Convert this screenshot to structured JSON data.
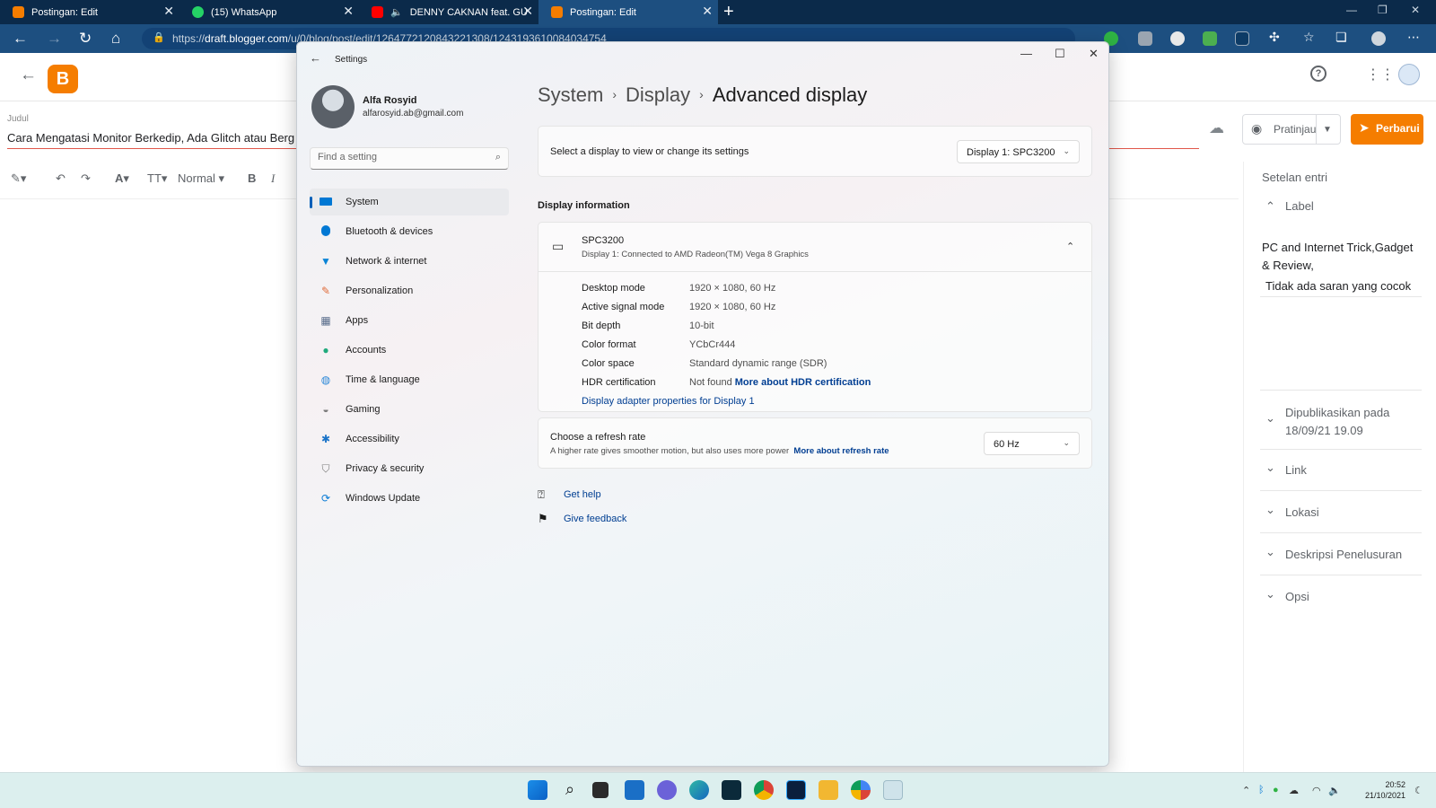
{
  "browser": {
    "tabs": [
      {
        "title": "Postingan: Edit",
        "icon": "blogger-icon",
        "color": "#f57d00"
      },
      {
        "title": "(15) WhatsApp",
        "icon": "whatsapp-icon",
        "color": "#25d366"
      },
      {
        "title": "DENNY CAKNAN feat. GUYON",
        "icon": "youtube-icon",
        "color": "#ff0000"
      },
      {
        "title": "Postingan: Edit",
        "icon": "blogger-icon",
        "color": "#f57d00"
      }
    ],
    "url_prefix": "https://",
    "url_host": "draft.blogger.com",
    "url_path": "/u/0/blog/post/edit/1264772120843221308/1243193610084034754"
  },
  "blogger": {
    "title_label": "Judul",
    "post_title": "Cara Mengatasi Monitor Berkedip, Ada Glitch atau Berg",
    "format_select": "Normal",
    "preview_label": "Pratinjau",
    "update_label": "Perbarui",
    "panel": {
      "heading": "Setelan entri",
      "label_section": "Label",
      "labels_value": "PC and Internet Trick,Gadget & Review,",
      "label_hint": "Tidak ada saran yang cocok",
      "published_title": "Dipublikasikan pada",
      "published_date": "18/09/21 19.09",
      "link": "Link",
      "location": "Lokasi",
      "search_desc": "Deskripsi Penelusuran",
      "options": "Opsi"
    }
  },
  "settings": {
    "caption": "Settings",
    "user": {
      "name": "Alfa Rosyid",
      "email": "alfarosyid.ab@gmail.com"
    },
    "search_placeholder": "Find a setting",
    "nav": [
      {
        "label": "System",
        "icon": "system-icon",
        "color": "#0078d4"
      },
      {
        "label": "Bluetooth & devices",
        "icon": "bluetooth-icon",
        "color": "#0078d4"
      },
      {
        "label": "Network & internet",
        "icon": "wifi-icon",
        "color": "#0a84d6"
      },
      {
        "label": "Personalization",
        "icon": "brush-icon",
        "color": "#e06c3a"
      },
      {
        "label": "Apps",
        "icon": "apps-icon",
        "color": "#5a6e8c"
      },
      {
        "label": "Accounts",
        "icon": "person-icon",
        "color": "#1faa7c"
      },
      {
        "label": "Time & language",
        "icon": "globe-clock-icon",
        "color": "#2b88d8"
      },
      {
        "label": "Gaming",
        "icon": "gamepad-icon",
        "color": "#7a7a7a"
      },
      {
        "label": "Accessibility",
        "icon": "accessibility-icon",
        "color": "#1a73c8"
      },
      {
        "label": "Privacy & security",
        "icon": "shield-icon",
        "color": "#7a7a7a"
      },
      {
        "label": "Windows Update",
        "icon": "update-icon",
        "color": "#0a7bd6"
      }
    ],
    "breadcrumb": [
      "System",
      "Display",
      "Advanced display"
    ],
    "select_display_text": "Select a display to view or change its settings",
    "display_dropdown": "Display 1: SPC3200",
    "display_info_heading": "Display information",
    "monitor": {
      "name": "SPC3200",
      "subtitle": "Display 1: Connected to AMD Radeon(TM) Vega 8 Graphics"
    },
    "info_rows": [
      {
        "key": "Desktop mode",
        "value": "1920 × 1080, 60 Hz"
      },
      {
        "key": "Active signal mode",
        "value": "1920 × 1080, 60 Hz"
      },
      {
        "key": "Bit depth",
        "value": "10-bit"
      },
      {
        "key": "Color format",
        "value": "YCbCr444"
      },
      {
        "key": "Color space",
        "value": "Standard dynamic range (SDR)"
      },
      {
        "key": "HDR certification",
        "value": "Not found",
        "link": "More about HDR certification"
      }
    ],
    "adapter_link": "Display adapter properties for Display 1",
    "refresh": {
      "title": "Choose a refresh rate",
      "desc": "A higher rate gives smoother motion, but also uses more power",
      "link": "More about refresh rate",
      "value": "60 Hz"
    },
    "get_help": "Get help",
    "give_feedback": "Give feedback"
  },
  "taskbar": {
    "time": "20:52",
    "date": "21/10/2021"
  }
}
